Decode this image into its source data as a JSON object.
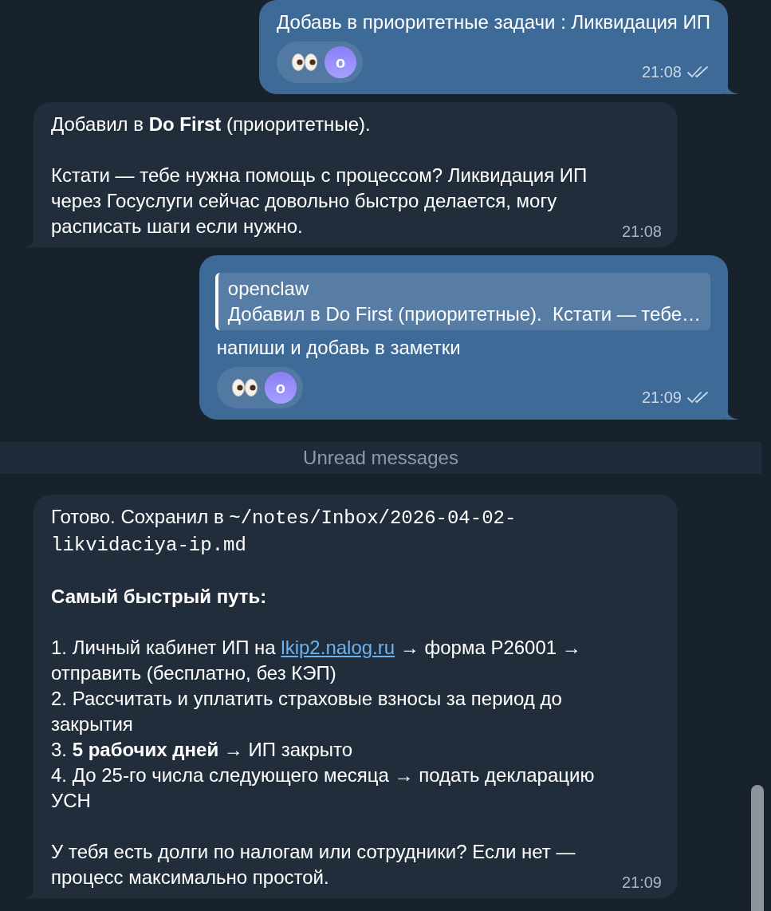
{
  "messages": [
    {
      "kind": "outgoing",
      "blocks": [
        [
          [
            {
              "kind": "text",
              "text": "Добавь в приоритетные задачи : Ликвидация ИП"
            }
          ]
        ]
      ],
      "reactions": [
        {
          "kind": "emoji"
        },
        {
          "kind": "avatar",
          "letter": "o"
        }
      ],
      "time": "21:08",
      "read": true
    },
    {
      "kind": "incoming",
      "blocks": [
        [
          [
            {
              "kind": "text",
              "text": "Добавил в **Do First** (приоритетные)."
            }
          ]
        ],
        [
          [
            {
              "kind": "text",
              "text": "Кстати — тебе нужна помощь с процессом? Ликвидация ИП через Госуслуги сейчас довольно быстро делается, могу расписать шаги если нужно."
            }
          ]
        ]
      ],
      "time": "21:08"
    },
    {
      "kind": "outgoing",
      "quote": {
        "author": "openclaw",
        "text": "Добавил в Do First (приоритетные).  Кстати — тебе…"
      },
      "blocks": [
        [
          [
            {
              "kind": "text",
              "text": "напиши и добавь в заметки"
            }
          ]
        ]
      ],
      "reactions": [
        {
          "kind": "emoji"
        },
        {
          "kind": "avatar",
          "letter": "o"
        }
      ],
      "time": "21:09",
      "read": true
    },
    {
      "kind": "divider",
      "text": "Unread messages"
    },
    {
      "kind": "incoming",
      "blocks": [
        [
          [
            {
              "kind": "text",
              "text": "Готово. Сохранил в "
            },
            {
              "kind": "code",
              "text": "~/notes/Inbox/2026-04-02-likvidaciya-ip.md"
            }
          ]
        ],
        [
          [
            {
              "kind": "text",
              "text": "**Самый быстрый путь:**"
            }
          ]
        ],
        [
          [
            {
              "kind": "text",
              "text": "1. Личный кабинет ИП на "
            },
            {
              "kind": "link",
              "text": "lkip2.nalog.ru"
            },
            {
              "kind": "text",
              "text": " → форма Р26001 → отправить (бесплатно, без КЭП)"
            }
          ],
          [
            {
              "kind": "text",
              "text": "2. Рассчитать и уплатить страховые взносы за период до закрытия"
            }
          ],
          [
            {
              "kind": "text",
              "text": "3. **5 рабочих дней** → ИП закрыто"
            }
          ],
          [
            {
              "kind": "text",
              "text": "4. До 25-го числа следующего месяца → подать декларацию УСН"
            }
          ]
        ],
        [
          [
            {
              "kind": "text",
              "text": "У тебя есть долги по налогам или сотрудники? Если нет — процесс максимально простой."
            }
          ]
        ]
      ],
      "time": "21:09"
    }
  ]
}
